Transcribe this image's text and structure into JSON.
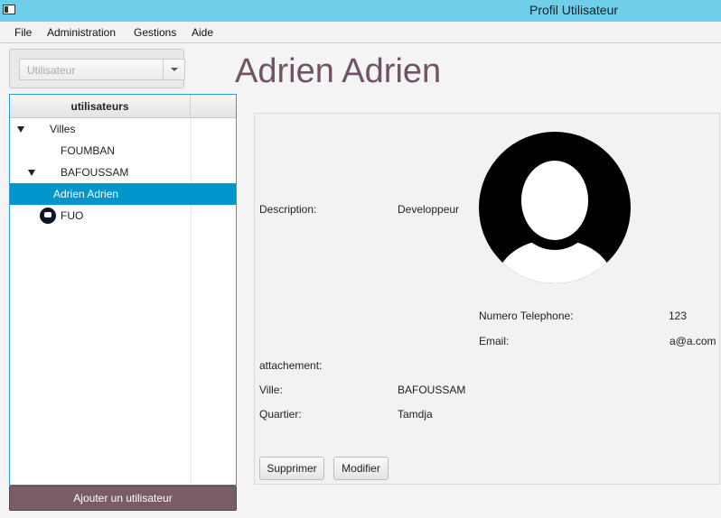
{
  "window": {
    "title": "Profil Utilisateur"
  },
  "menu": {
    "items": [
      "File",
      "Administration",
      "Gestions",
      "Aide"
    ]
  },
  "search_combo": {
    "placeholder": "Utilisateur"
  },
  "tree": {
    "column_header": "utilisateurs",
    "nodes": {
      "villes": "Villes",
      "foumban": "FOUMBAN",
      "bafoussam": "BAFOUSSAM",
      "selected_user": "Adrien Adrien",
      "fuo": "FUO"
    }
  },
  "add_user_button": "Ajouter un utilisateur",
  "profile": {
    "name": "Adrien Adrien",
    "description_label": "Description:",
    "description_value": "Developpeur",
    "phone_label": "Numero Telephone:",
    "phone_value": "123",
    "email_label": "Email:",
    "email_value": "a@a.com",
    "attachment_label": "attachement:",
    "city_label": "Ville:",
    "city_value": "BAFOUSSAM",
    "district_label": "Quartier:",
    "district_value": "Tamdja"
  },
  "actions": {
    "delete": "Supprimer",
    "edit": "Modifier"
  },
  "colors": {
    "titlebar": "#6fcfeb",
    "accent": "#6e5464",
    "selection": "#0096c9",
    "add_button": "#7a5c68"
  }
}
